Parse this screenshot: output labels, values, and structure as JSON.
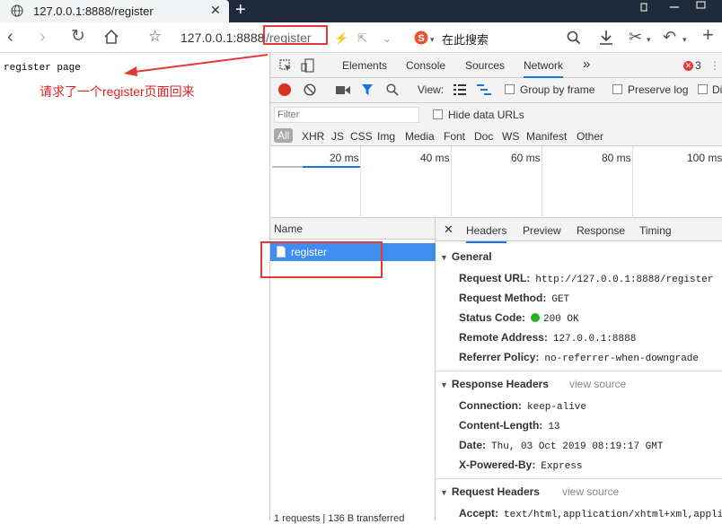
{
  "browser": {
    "tab_title": "127.0.0.1:8888/register",
    "new_tab": "+",
    "url_host": "127.0.0.1:8888",
    "url_path": "/register",
    "search_label": "在此搜索"
  },
  "page": {
    "body_text": "register page",
    "annotation": "请求了一个register页面回来"
  },
  "devtools": {
    "tabs": [
      "Elements",
      "Console",
      "Sources",
      "Network"
    ],
    "more": "»",
    "error_count": "3",
    "toolbar": {
      "view_label": "View:",
      "group_by_frame": "Group by frame",
      "preserve_log": "Preserve log",
      "disable_cache": "Di"
    },
    "filter_placeholder": "Filter",
    "hide_data_urls": "Hide data URLs",
    "types": [
      "All",
      "XHR",
      "JS",
      "CSS",
      "Img",
      "Media",
      "Font",
      "Doc",
      "WS",
      "Manifest",
      "Other"
    ],
    "timeline_labels": [
      "20 ms",
      "40 ms",
      "60 ms",
      "80 ms",
      "100 ms"
    ],
    "name_column": "Name",
    "requests": [
      {
        "name": "register"
      }
    ],
    "detail_tabs": [
      "Headers",
      "Preview",
      "Response",
      "Timing"
    ],
    "general": {
      "title": "General",
      "request_url_k": "Request URL:",
      "request_url_v": "http://127.0.0.1:8888/register",
      "method_k": "Request Method:",
      "method_v": "GET",
      "status_k": "Status Code:",
      "status_v": "200 OK",
      "remote_k": "Remote Address:",
      "remote_v": "127.0.0.1:8888",
      "referrer_k": "Referrer Policy:",
      "referrer_v": "no-referrer-when-downgrade"
    },
    "response_headers": {
      "title": "Response Headers",
      "view_source": "view source",
      "connection_k": "Connection:",
      "connection_v": "keep-alive",
      "length_k": "Content-Length:",
      "length_v": "13",
      "date_k": "Date:",
      "date_v": "Thu, 03 Oct 2019 08:19:17 GMT",
      "powered_k": "X-Powered-By:",
      "powered_v": "Express"
    },
    "request_headers": {
      "title": "Request Headers",
      "view_source": "view source",
      "accept_k": "Accept:",
      "accept_v": "text/html,application/xhtml+xml,applic"
    },
    "status_bar": "1 requests | 136 B transferred"
  },
  "colors": {
    "accent": "#1a73e8",
    "annotation_red": "#e53935",
    "selected_row": "#3d8ef0",
    "status_green": "#21b321"
  }
}
